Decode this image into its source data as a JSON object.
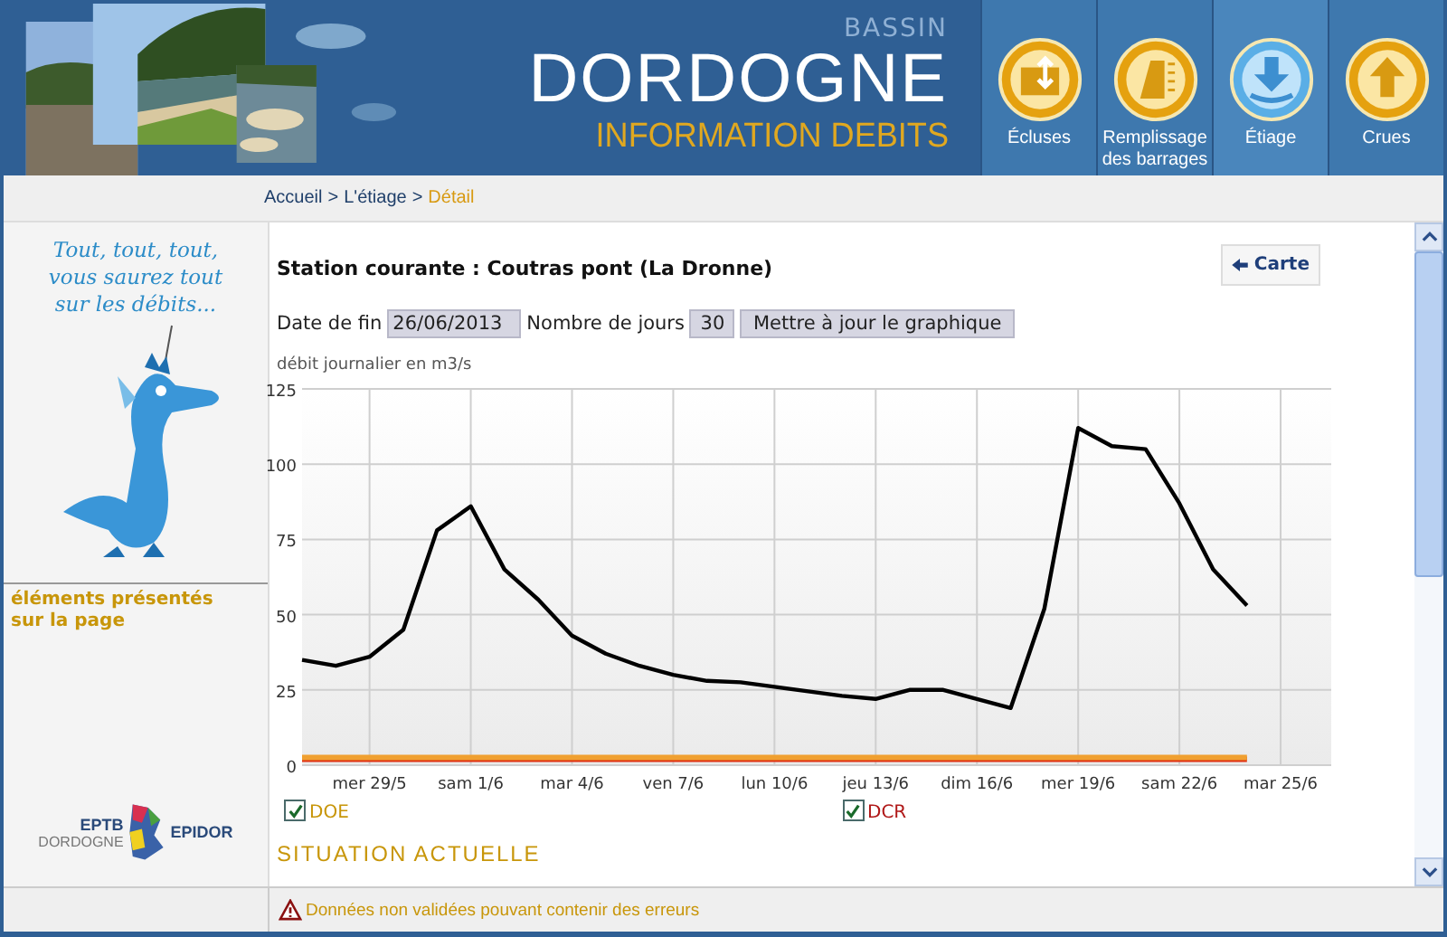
{
  "header": {
    "kicker": "BASSIN",
    "title": "DORDOGNE",
    "subtitle": "INFORMATION DEBITS",
    "nav": [
      {
        "label": "Écluses",
        "selected": false
      },
      {
        "label": "Remplissage des barrages",
        "selected": false
      },
      {
        "label": "Étiage",
        "selected": true
      },
      {
        "label": "Crues",
        "selected": false
      }
    ]
  },
  "breadcrumb": [
    {
      "label": "Accueil",
      "current": false
    },
    {
      "label": "L'étiage",
      "current": false
    },
    {
      "label": "Détail",
      "current": true
    }
  ],
  "breadcrumb_separator": ">",
  "sidebar": {
    "speech": "Tout, tout, tout, vous saurez tout sur les débits...",
    "elements_heading": "éléments présentés sur la page",
    "logo_left": "EPTB",
    "logo_left_sub": "DORDOGNE",
    "logo_right": "EPIDOR"
  },
  "station_title": "Station courante : Coutras pont (La Dronne)",
  "map_button": "Carte",
  "form": {
    "end_label": "Date de fin",
    "end_value": "26/06/2013",
    "days_label": "Nombre de jours",
    "days_value": "30",
    "update_button": "Mettre à jour le graphique"
  },
  "chart": {
    "chart_data": {
      "type": "line",
      "ylabel": "débit journalier en m3/s",
      "categories": [
        null,
        null,
        "mer 29/5",
        null,
        null,
        "sam 1/6",
        null,
        null,
        "mar 4/6",
        null,
        null,
        "ven 7/6",
        null,
        null,
        "lun 10/6",
        null,
        null,
        "jeu 13/6",
        null,
        null,
        "dim 16/6",
        null,
        null,
        "mer 19/6",
        null,
        null,
        "sam 22/6",
        null,
        null,
        "mar 25/6",
        null
      ],
      "series": [
        {
          "color": "#000000",
          "values": [
            35,
            33,
            36,
            45,
            78,
            86,
            65,
            55,
            43,
            37,
            33,
            30,
            28,
            27.5,
            26,
            24.5,
            23,
            22,
            25,
            25,
            22,
            19,
            52,
            112,
            106,
            105,
            87,
            65,
            53,
            null,
            null
          ]
        },
        {
          "name": "DOE",
          "color": "#f0a030",
          "values": [
            2.5,
            2.5,
            2.5,
            2.5,
            2.5,
            2.5,
            2.5,
            2.5,
            2.5,
            2.5,
            2.5,
            2.5,
            2.5,
            2.5,
            2.5,
            2.5,
            2.5,
            2.5,
            2.5,
            2.5,
            2.5,
            2.5,
            2.5,
            2.5,
            2.5,
            2.5,
            2.5,
            2.5,
            2.5,
            null,
            null
          ]
        },
        {
          "name": "DCR",
          "color": "#e03010",
          "values": [
            2,
            2,
            2,
            2,
            2,
            2,
            2,
            2,
            2,
            2,
            2,
            2,
            2,
            2,
            2,
            2,
            2,
            2,
            2,
            2,
            2,
            2,
            2,
            2,
            2,
            2,
            2,
            2,
            2,
            null,
            null
          ]
        }
      ],
      "ylim": [
        0,
        125
      ],
      "yticks": [
        0,
        25,
        50,
        75,
        100,
        125
      ],
      "grid": true
    },
    "legend": [
      {
        "checked": true,
        "color": "#c8960a"
      },
      {
        "checked": true,
        "color": "#b01818"
      }
    ]
  },
  "section_heading": "SITUATION ACTUELLE",
  "footer_warning": "Données non validées pouvant contenir des erreurs"
}
